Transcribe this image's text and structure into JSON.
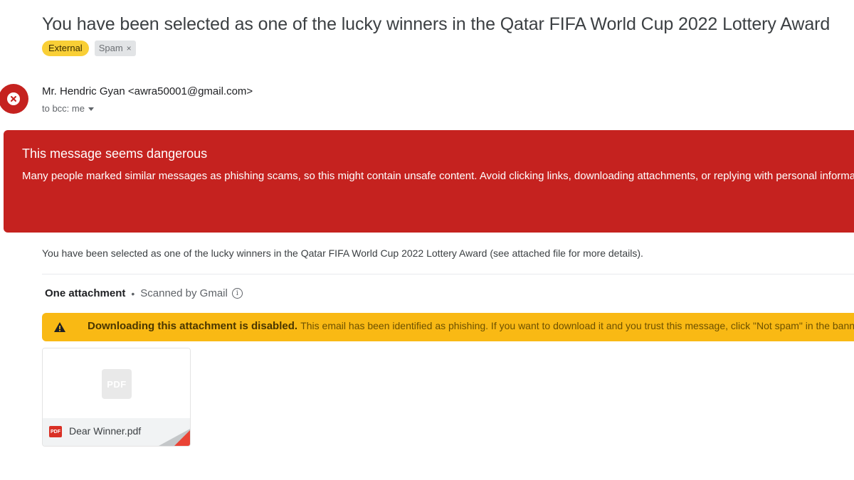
{
  "email": {
    "subject": "You have been selected as one of the lucky winners in the Qatar FIFA World Cup 2022 Lottery Award",
    "labels": [
      {
        "text": "External",
        "color": "#f9cf36"
      },
      {
        "text": "Spam",
        "remove_symbol": "×",
        "color": "#e2e4e6"
      }
    ],
    "sender": {
      "display": "Mr. Hendric Gyan <awra50001@gmail.com>",
      "avatar_icon": "close-icon",
      "avatar_color": "#c5221f"
    },
    "recipient": "to bcc: me",
    "danger_banner": {
      "title": "This message seems dangerous",
      "text": "Many people marked similar messages as phishing scams, so this might contain unsafe content. Avoid clicking links, downloading attachments, or replying with personal information.",
      "color": "#c5221f"
    },
    "body": "You have been selected as one of the lucky winners in the Qatar FIFA World Cup 2022 Lottery Award (see attached file for more details).",
    "attachments": {
      "count_label": "One attachment",
      "separator": "•",
      "scan_label": "Scanned by Gmail",
      "info_icon": "ⓘ",
      "warning": {
        "icon": "warning-icon",
        "strong": "Downloading this attachment is disabled.",
        "text": "This email has been identified as phishing. If you want to download it and you trust this message, click \"Not spam\" in the banner above.",
        "color": "#f9b914"
      },
      "files": [
        {
          "name": "Dear Winner.pdf",
          "type_label": "PDF",
          "icon_label": "PDF"
        }
      ]
    }
  }
}
